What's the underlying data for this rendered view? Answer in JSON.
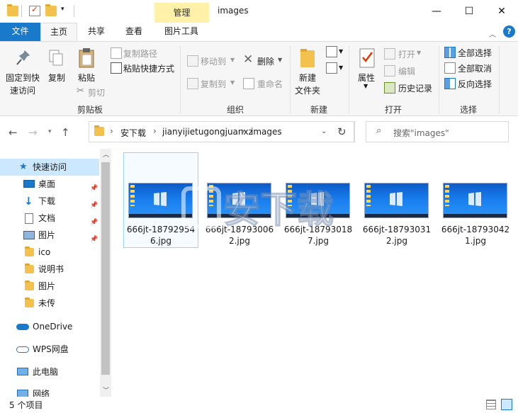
{
  "window": {
    "title": "images",
    "contextual_group": "管理",
    "minimize": "—",
    "maximize": "☐",
    "close": "✕"
  },
  "tabs": [
    "文件",
    "主页",
    "共享",
    "查看",
    "图片工具"
  ],
  "ribbon": {
    "clipboard": {
      "pin_label_1": "固定到快",
      "pin_label_2": "速访问",
      "copy": "复制",
      "paste": "粘贴",
      "copy_path": "复制路径",
      "paste_shortcut": "粘贴快捷方式",
      "cut": "剪切",
      "group": "剪贴板"
    },
    "organize": {
      "move_to": "移动到",
      "copy_to": "复制到",
      "delete": "删除",
      "rename": "重命名",
      "group": "组织"
    },
    "new": {
      "new_folder_1": "新建",
      "new_folder_2": "文件夹",
      "group": "新建"
    },
    "open": {
      "properties": "属性",
      "open": "打开",
      "edit": "编辑",
      "history": "历史记录",
      "group": "打开"
    },
    "select": {
      "select_all": "全部选择",
      "select_none": "全部取消",
      "invert": "反向选择",
      "group": "选择"
    }
  },
  "address": {
    "crumbs": [
      "安下载",
      "jianyijietugongjuanxz",
      "images"
    ],
    "search_placeholder": "搜索\"images\""
  },
  "nav": {
    "quick_access": "快速访问",
    "items": [
      "桌面",
      "下载",
      "文档",
      "图片",
      "ico",
      "说明书",
      "图片",
      "未传"
    ],
    "onedrive": "OneDrive",
    "wps": "WPS网盘",
    "this_pc": "此电脑",
    "network": "网络"
  },
  "files": [
    {
      "line1": "666jt-18792954",
      "line2": "6.jpg"
    },
    {
      "line1": "666jt-18793006",
      "line2": "2.jpg"
    },
    {
      "line1": "666jt-18793018",
      "line2": "7.jpg"
    },
    {
      "line1": "666jt-18793031",
      "line2": "2.jpg"
    },
    {
      "line1": "666jt-18793042",
      "line2": "1.jpg"
    }
  ],
  "status": {
    "count": "5 个项目"
  },
  "watermark": "安下载"
}
